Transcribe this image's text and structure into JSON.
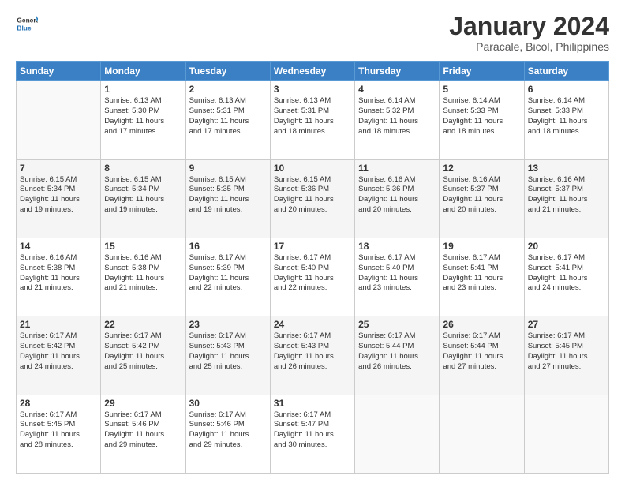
{
  "header": {
    "logo_general": "General",
    "logo_blue": "Blue",
    "title": "January 2024",
    "subtitle": "Paracale, Bicol, Philippines"
  },
  "columns": [
    "Sunday",
    "Monday",
    "Tuesday",
    "Wednesday",
    "Thursday",
    "Friday",
    "Saturday"
  ],
  "weeks": [
    [
      {
        "day": "",
        "info": ""
      },
      {
        "day": "1",
        "info": "Sunrise: 6:13 AM\nSunset: 5:30 PM\nDaylight: 11 hours\nand 17 minutes."
      },
      {
        "day": "2",
        "info": "Sunrise: 6:13 AM\nSunset: 5:31 PM\nDaylight: 11 hours\nand 17 minutes."
      },
      {
        "day": "3",
        "info": "Sunrise: 6:13 AM\nSunset: 5:31 PM\nDaylight: 11 hours\nand 18 minutes."
      },
      {
        "day": "4",
        "info": "Sunrise: 6:14 AM\nSunset: 5:32 PM\nDaylight: 11 hours\nand 18 minutes."
      },
      {
        "day": "5",
        "info": "Sunrise: 6:14 AM\nSunset: 5:33 PM\nDaylight: 11 hours\nand 18 minutes."
      },
      {
        "day": "6",
        "info": "Sunrise: 6:14 AM\nSunset: 5:33 PM\nDaylight: 11 hours\nand 18 minutes."
      }
    ],
    [
      {
        "day": "7",
        "info": "Sunrise: 6:15 AM\nSunset: 5:34 PM\nDaylight: 11 hours\nand 19 minutes."
      },
      {
        "day": "8",
        "info": "Sunrise: 6:15 AM\nSunset: 5:34 PM\nDaylight: 11 hours\nand 19 minutes."
      },
      {
        "day": "9",
        "info": "Sunrise: 6:15 AM\nSunset: 5:35 PM\nDaylight: 11 hours\nand 19 minutes."
      },
      {
        "day": "10",
        "info": "Sunrise: 6:15 AM\nSunset: 5:36 PM\nDaylight: 11 hours\nand 20 minutes."
      },
      {
        "day": "11",
        "info": "Sunrise: 6:16 AM\nSunset: 5:36 PM\nDaylight: 11 hours\nand 20 minutes."
      },
      {
        "day": "12",
        "info": "Sunrise: 6:16 AM\nSunset: 5:37 PM\nDaylight: 11 hours\nand 20 minutes."
      },
      {
        "day": "13",
        "info": "Sunrise: 6:16 AM\nSunset: 5:37 PM\nDaylight: 11 hours\nand 21 minutes."
      }
    ],
    [
      {
        "day": "14",
        "info": "Sunrise: 6:16 AM\nSunset: 5:38 PM\nDaylight: 11 hours\nand 21 minutes."
      },
      {
        "day": "15",
        "info": "Sunrise: 6:16 AM\nSunset: 5:38 PM\nDaylight: 11 hours\nand 21 minutes."
      },
      {
        "day": "16",
        "info": "Sunrise: 6:17 AM\nSunset: 5:39 PM\nDaylight: 11 hours\nand 22 minutes."
      },
      {
        "day": "17",
        "info": "Sunrise: 6:17 AM\nSunset: 5:40 PM\nDaylight: 11 hours\nand 22 minutes."
      },
      {
        "day": "18",
        "info": "Sunrise: 6:17 AM\nSunset: 5:40 PM\nDaylight: 11 hours\nand 23 minutes."
      },
      {
        "day": "19",
        "info": "Sunrise: 6:17 AM\nSunset: 5:41 PM\nDaylight: 11 hours\nand 23 minutes."
      },
      {
        "day": "20",
        "info": "Sunrise: 6:17 AM\nSunset: 5:41 PM\nDaylight: 11 hours\nand 24 minutes."
      }
    ],
    [
      {
        "day": "21",
        "info": "Sunrise: 6:17 AM\nSunset: 5:42 PM\nDaylight: 11 hours\nand 24 minutes."
      },
      {
        "day": "22",
        "info": "Sunrise: 6:17 AM\nSunset: 5:42 PM\nDaylight: 11 hours\nand 25 minutes."
      },
      {
        "day": "23",
        "info": "Sunrise: 6:17 AM\nSunset: 5:43 PM\nDaylight: 11 hours\nand 25 minutes."
      },
      {
        "day": "24",
        "info": "Sunrise: 6:17 AM\nSunset: 5:43 PM\nDaylight: 11 hours\nand 26 minutes."
      },
      {
        "day": "25",
        "info": "Sunrise: 6:17 AM\nSunset: 5:44 PM\nDaylight: 11 hours\nand 26 minutes."
      },
      {
        "day": "26",
        "info": "Sunrise: 6:17 AM\nSunset: 5:44 PM\nDaylight: 11 hours\nand 27 minutes."
      },
      {
        "day": "27",
        "info": "Sunrise: 6:17 AM\nSunset: 5:45 PM\nDaylight: 11 hours\nand 27 minutes."
      }
    ],
    [
      {
        "day": "28",
        "info": "Sunrise: 6:17 AM\nSunset: 5:45 PM\nDaylight: 11 hours\nand 28 minutes."
      },
      {
        "day": "29",
        "info": "Sunrise: 6:17 AM\nSunset: 5:46 PM\nDaylight: 11 hours\nand 29 minutes."
      },
      {
        "day": "30",
        "info": "Sunrise: 6:17 AM\nSunset: 5:46 PM\nDaylight: 11 hours\nand 29 minutes."
      },
      {
        "day": "31",
        "info": "Sunrise: 6:17 AM\nSunset: 5:47 PM\nDaylight: 11 hours\nand 30 minutes."
      },
      {
        "day": "",
        "info": ""
      },
      {
        "day": "",
        "info": ""
      },
      {
        "day": "",
        "info": ""
      }
    ]
  ]
}
